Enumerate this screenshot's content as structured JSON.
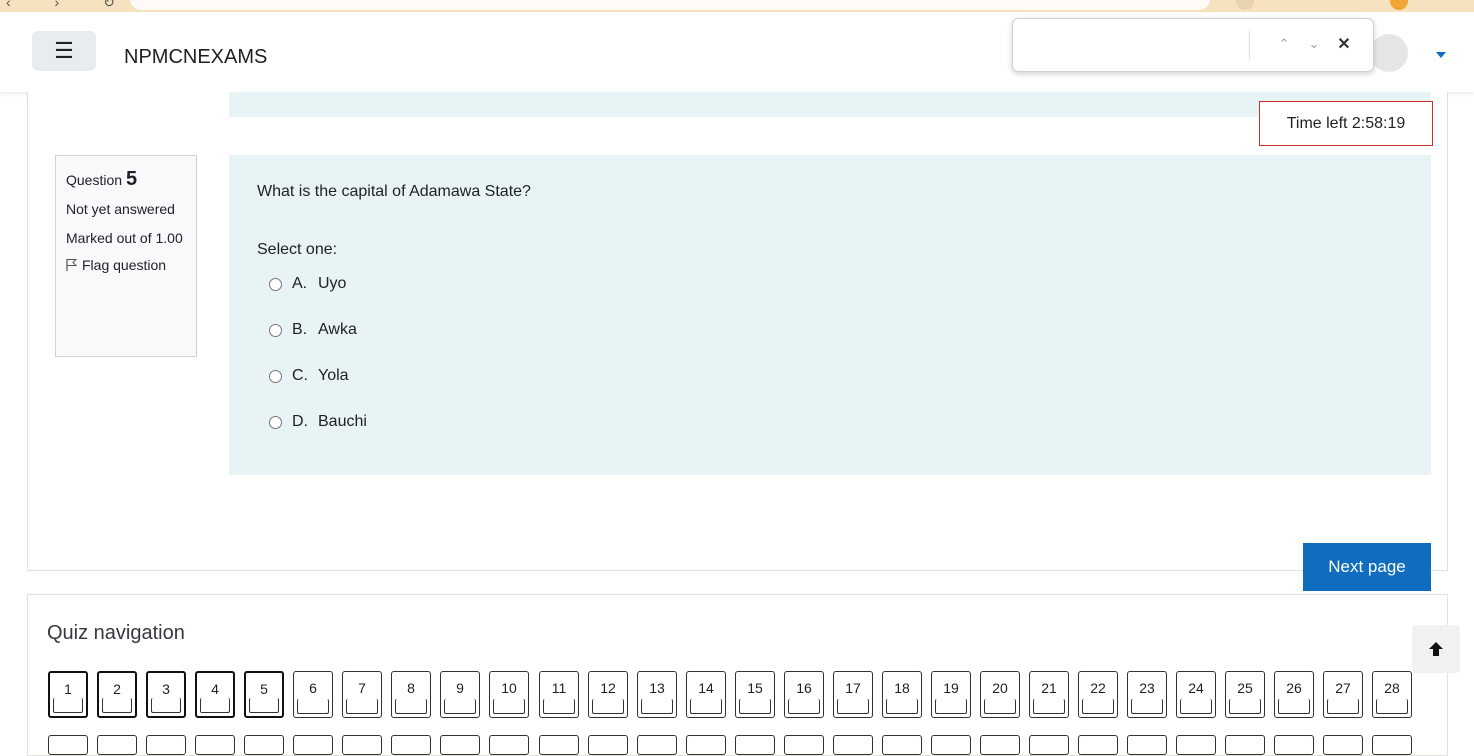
{
  "browser": {
    "nav_glyphs": "‹ › ↻",
    "ext_colors": [
      "#f3a533",
      "#e8d2b0"
    ]
  },
  "navbar": {
    "menu_icon": "☰",
    "brand": "NPMCNEXAMS"
  },
  "find_bar": {
    "value": "",
    "prev": "⌃",
    "next": "⌄",
    "close": "✕"
  },
  "timer": {
    "text": "Time left 2:58:19"
  },
  "question": {
    "label": "Question",
    "number": "5",
    "status": "Not yet answered",
    "marks": "Marked out of 1.00",
    "flag_label": "Flag question",
    "text": "What is the capital of Adamawa State?",
    "prompt": "Select one:",
    "answers": [
      {
        "letter": "A.",
        "text": "Uyo"
      },
      {
        "letter": "B.",
        "text": "Awka"
      },
      {
        "letter": "C.",
        "text": "Yola"
      },
      {
        "letter": "D.",
        "text": "Bauchi"
      }
    ]
  },
  "next_button": "Next page",
  "quiz_nav": {
    "title": "Quiz navigation",
    "buttons": [
      "1",
      "2",
      "3",
      "4",
      "5",
      "6",
      "7",
      "8",
      "9",
      "10",
      "11",
      "12",
      "13",
      "14",
      "15",
      "16",
      "17",
      "18",
      "19",
      "20",
      "21",
      "22",
      "23",
      "24",
      "25",
      "26",
      "27",
      "28"
    ],
    "current_upto": 5
  }
}
